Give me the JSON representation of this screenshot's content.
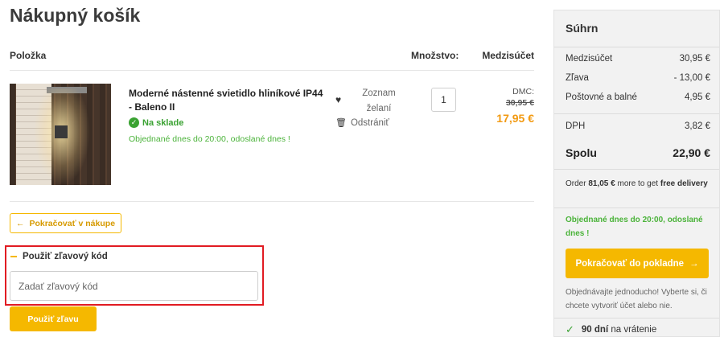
{
  "page": {
    "title": "Nákupný košík"
  },
  "table": {
    "col_item": "Položka",
    "col_qty": "Množstvo:",
    "col_subtotal": "Medzisúčet"
  },
  "item": {
    "name": "Moderné nástenné svietidlo hliníkové IP44 - Baleno II",
    "stock": "Na sklade",
    "ship_note": "Objednané dnes do 20:00, odoslané dnes !",
    "wishlist_label": "Zoznam želaní",
    "remove_label": "Odstrániť",
    "quantity": "1",
    "dmc_label": "DMC:",
    "old_price": "30,95 €",
    "price": "17,95 €"
  },
  "actions": {
    "continue_label": "Pokračovať v nákupe"
  },
  "discount": {
    "title": "Použiť zľavový kód",
    "placeholder": "Zadať zľavový kód",
    "apply_label": "Použiť zľavu"
  },
  "summary": {
    "title": "Súhrn",
    "rows": [
      {
        "label": "Medzisúčet",
        "value": "30,95 €"
      },
      {
        "label": "Zľava",
        "value": "- 13,00 €"
      },
      {
        "label": "Poštovné a balné",
        "value": "4,95 €"
      },
      {
        "label": "DPH",
        "value": "3,82 €"
      }
    ],
    "total_label": "Spolu",
    "total_value": "22,90 €",
    "free_ship_prefix": "Order ",
    "free_ship_amount": "81,05 €",
    "free_ship_mid": " more to get ",
    "free_ship_bold": "free delivery",
    "ship_note": "Objednané dnes do 20:00, odoslané dnes !",
    "checkout_label": "Pokračovať do pokladne",
    "hint": "Objednávajte jednoducho! Vyberte si, či chcete vytvoriť účet alebo nie.",
    "returns_bold": "90 dní",
    "returns_text": "na vrátenie"
  },
  "colors": {
    "accent": "#f5b800",
    "price": "#f29a12",
    "success": "#3aa232",
    "highlight": "#e11b22"
  },
  "icons": [
    "heart-icon",
    "trash-icon",
    "check-circle-icon",
    "arrow-left-icon",
    "arrow-right-icon",
    "minus-icon",
    "check-icon"
  ]
}
